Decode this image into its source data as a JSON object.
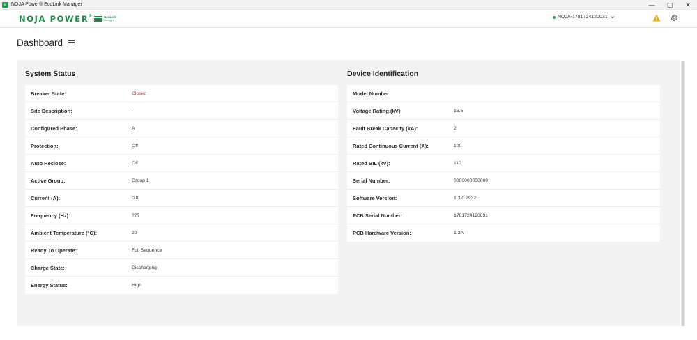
{
  "window": {
    "title": "NOJA Power® EcoLink Manager",
    "minimize": "—",
    "maximize": "▢",
    "close": "✕"
  },
  "header": {
    "logo_text": "NOJA POWER",
    "logo_reg": "®",
    "logo_badge_line1": "EcoLink",
    "logo_badge_line2": "Manager",
    "device_name": "NOJA-1781724120031",
    "device_status_color": "#2eaa55",
    "warning_color": "#f2a900",
    "brand_color": "#1f8a46",
    "icons": [
      "warning-icon",
      "gear-icon",
      "chevron-down-icon",
      "menu-icon"
    ]
  },
  "page": {
    "title": "Dashboard"
  },
  "system_status": {
    "title": "System Status",
    "rows": [
      {
        "label": "Breaker State:",
        "value": "Closed",
        "color": "#d32f2f"
      },
      {
        "label": "Site Description:",
        "value": "-"
      },
      {
        "label": "Configured Phase:",
        "value": "A"
      },
      {
        "label": "Protection:",
        "value": "Off"
      },
      {
        "label": "Auto Reclose:",
        "value": "Off"
      },
      {
        "label": "Active Group:",
        "value": "Group 1"
      },
      {
        "label": "Current (A):",
        "value": "0.0"
      },
      {
        "label": "Frequency (Hz):",
        "value": "???"
      },
      {
        "label": "Ambient Temperature (°C):",
        "value": "20"
      },
      {
        "label": "Ready To Operate:",
        "value": "Full Sequence"
      },
      {
        "label": "Charge State:",
        "value": "Discharging"
      },
      {
        "label": "Energy Status:",
        "value": "High"
      }
    ]
  },
  "device_identification": {
    "title": "Device Identification",
    "rows": [
      {
        "label": "Model Number:",
        "value": ""
      },
      {
        "label": "Voltage Rating (kV):",
        "value": "15.5"
      },
      {
        "label": "Fault Break Capacity (kA):",
        "value": "2"
      },
      {
        "label": "Rated Continuous Current (A):",
        "value": "100"
      },
      {
        "label": "Rated BIL (kV):",
        "value": "110"
      },
      {
        "label": "Serial Number:",
        "value": "0000000000000"
      },
      {
        "label": "Software Version:",
        "value": "1.3.0.2932"
      },
      {
        "label": "PCB Serial Number:",
        "value": "1781724120031"
      },
      {
        "label": "PCB Hardware Version:",
        "value": "1.2A"
      }
    ]
  }
}
